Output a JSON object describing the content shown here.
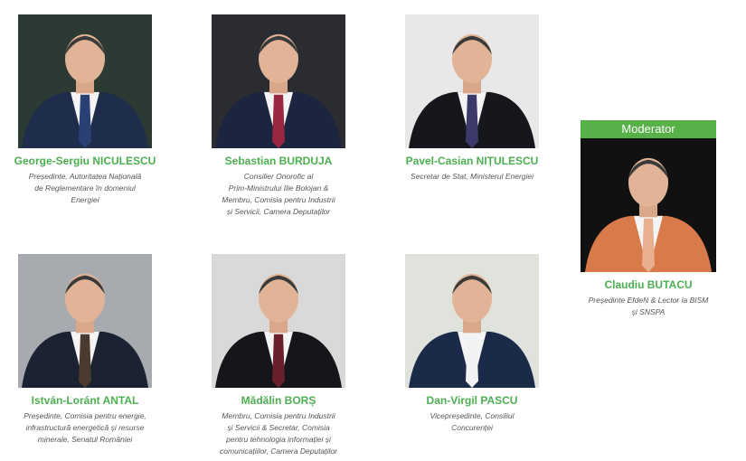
{
  "moderator_banner": "Moderator",
  "speakers": [
    {
      "name": "George-Sergiu NICULESCU",
      "role_lines": [
        "Președinte, Autoritatea Națională",
        "de Reglementare în domeniul",
        "Energiei"
      ],
      "photo_bg": "#2b3a33",
      "suit": "#1f2d4d",
      "tie": "#2a3f73"
    },
    {
      "name": "Sebastian BURDUJA",
      "role_lines": [
        "Consilier Onorofic al",
        "Prim-Ministrului Ilie Bolojan &",
        "Membru, Comisia pentru Industrii",
        "și Servicii, Camera Deputaților"
      ],
      "photo_bg": "#2a2c31",
      "suit": "#1b2540",
      "tie": "#9a2740"
    },
    {
      "name": "Pavel-Casian NIȚULESCU",
      "role_lines": [
        "Secretar de Stat, Ministerul Energiei"
      ],
      "photo_bg": "#e8e8e8",
      "suit": "#15171c",
      "tie": "#3c3a6a"
    },
    {
      "name": "István-Loránt ANTAL",
      "role_lines": [
        "Președinte, Comisia pentru energie,",
        "infrastructură energetică și resurse",
        "minerale, Senatul României"
      ],
      "photo_bg": "#a7abaf",
      "suit": "#1b2333",
      "tie": "#4a3b2e"
    },
    {
      "name": "Mădălin BORȘ",
      "role_lines": [
        "Membru, Comisia pentru Industrii",
        "și Servicii & Secretar, Comisia",
        "pentru tehnologia informației și",
        "comunicațiilor, Camera Deputaților"
      ],
      "photo_bg": "#d9d9d9",
      "suit": "#15161a",
      "tie": "#6b1f2a"
    },
    {
      "name": "Dan-Virgil PASCU",
      "role_lines": [
        "Vicepreședinte, Consiliul",
        "Concurenței"
      ],
      "photo_bg": "#dfe3dc",
      "suit": "#1c2a4a",
      "tie": "#f2f2f2"
    }
  ],
  "moderator": {
    "name": "Claudiu BUTACU",
    "role_lines": [
      "Președinte EfdeN & Lector la BISM",
      "și SNSPA"
    ],
    "photo_bg": "#111111",
    "suit": "#d97a4a",
    "tie": "#e8b08e"
  },
  "colors": {
    "name_green": "#4caf50",
    "banner_green": "#58b048"
  },
  "icons": [
    "person-photo-icon"
  ]
}
